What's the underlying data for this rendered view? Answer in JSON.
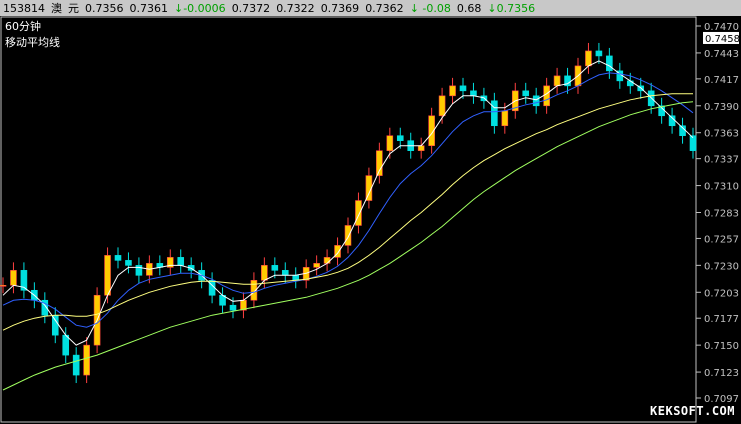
{
  "header": {
    "code": "153814",
    "name1": "澳",
    "name2": "元",
    "open": "0.7356",
    "high": "0.7361",
    "change": "↓-0.0006",
    "v1": "0.7372",
    "v2": "0.7322",
    "v3": "0.7369",
    "v4": "0.7362",
    "change2": "↓ -0.08",
    "v5": "0.68",
    "change3": "↓0.7356"
  },
  "overlay": {
    "period": "60分钟",
    "indicator": "移动平均线"
  },
  "watermark": "KEKSOFT.COM",
  "colors": {
    "up": "#ff4040",
    "down": "#00e0e0",
    "bull_body": "#ffcc00",
    "ma_short": "#ffffff",
    "ma_mid": "#3060ff",
    "ma_long": "#ffff80",
    "ma_longer": "#a0ff60",
    "axis": "#c0c0c0",
    "price_box": "#ffffff"
  },
  "chart_data": {
    "type": "line",
    "ylim": [
      0.7097,
      0.747
    ],
    "yticks": [
      "0.7470",
      "0.7443",
      "0.7417",
      "0.7390",
      "0.7363",
      "0.7337",
      "0.7310",
      "0.7283",
      "0.7257",
      "0.7230",
      "0.7203",
      "0.7177",
      "0.7150",
      "0.7123",
      "0.7097"
    ],
    "current_price": "0.7458",
    "series": [
      {
        "key": "price",
        "values": [
          0.721,
          0.7225,
          0.7205,
          0.7195,
          0.718,
          0.716,
          0.714,
          0.712,
          0.715,
          0.72,
          0.724,
          0.7235,
          0.723,
          0.722,
          0.7232,
          0.7228,
          0.7238,
          0.723,
          0.7225,
          0.7215,
          0.72,
          0.719,
          0.7185,
          0.7195,
          0.7215,
          0.723,
          0.7225,
          0.722,
          0.7215,
          0.7228,
          0.7232,
          0.7238,
          0.725,
          0.727,
          0.7295,
          0.732,
          0.7345,
          0.736,
          0.7355,
          0.7345,
          0.735,
          0.738,
          0.74,
          0.741,
          0.7405,
          0.74,
          0.7395,
          0.737,
          0.7385,
          0.7405,
          0.74,
          0.739,
          0.741,
          0.742,
          0.741,
          0.743,
          0.7445,
          0.744,
          0.7425,
          0.7415,
          0.741,
          0.7405,
          0.739,
          0.738,
          0.737,
          0.736,
          0.7345
        ]
      },
      {
        "key": "ma_short",
        "values": [
          0.72,
          0.721,
          0.7208,
          0.72,
          0.719,
          0.7175,
          0.716,
          0.715,
          0.7155,
          0.7175,
          0.72,
          0.722,
          0.7228,
          0.7228,
          0.7226,
          0.7228,
          0.723,
          0.723,
          0.7227,
          0.722,
          0.721,
          0.72,
          0.7194,
          0.7195,
          0.7203,
          0.7215,
          0.722,
          0.722,
          0.722,
          0.7222,
          0.7226,
          0.7232,
          0.7242,
          0.7258,
          0.728,
          0.7302,
          0.7325,
          0.7342,
          0.735,
          0.735,
          0.735,
          0.7362,
          0.7378,
          0.7392,
          0.74,
          0.74,
          0.7398,
          0.7388,
          0.7388,
          0.7395,
          0.7398,
          0.7396,
          0.7402,
          0.741,
          0.7412,
          0.742,
          0.743,
          0.7435,
          0.743,
          0.7422,
          0.7415,
          0.7408,
          0.7398,
          0.7388,
          0.7378,
          0.7368,
          0.7358
        ]
      },
      {
        "key": "ma_mid",
        "values": [
          0.719,
          0.7195,
          0.7196,
          0.7195,
          0.7192,
          0.7186,
          0.7178,
          0.717,
          0.7168,
          0.7172,
          0.7182,
          0.7195,
          0.7205,
          0.7212,
          0.7216,
          0.7218,
          0.722,
          0.7222,
          0.7222,
          0.722,
          0.7216,
          0.721,
          0.7205,
          0.7202,
          0.7203,
          0.7207,
          0.721,
          0.7212,
          0.7214,
          0.7216,
          0.7219,
          0.7223,
          0.7229,
          0.7238,
          0.725,
          0.7265,
          0.7282,
          0.7298,
          0.7312,
          0.7322,
          0.733,
          0.734,
          0.7352,
          0.7364,
          0.7374,
          0.738,
          0.7384,
          0.7384,
          0.7385,
          0.7388,
          0.7391,
          0.7393,
          0.7396,
          0.7401,
          0.7405,
          0.741,
          0.7416,
          0.7421,
          0.7423,
          0.7422,
          0.742,
          0.7416,
          0.7411,
          0.7405,
          0.7398,
          0.7391,
          0.7383
        ]
      },
      {
        "key": "ma_long",
        "values": [
          0.7165,
          0.717,
          0.7174,
          0.7177,
          0.7179,
          0.718,
          0.718,
          0.7179,
          0.7179,
          0.7181,
          0.7185,
          0.719,
          0.7195,
          0.7199,
          0.7203,
          0.7206,
          0.7209,
          0.7211,
          0.7213,
          0.7214,
          0.7214,
          0.7213,
          0.7212,
          0.7211,
          0.7211,
          0.7212,
          0.7213,
          0.7214,
          0.7215,
          0.7216,
          0.7218,
          0.722,
          0.7223,
          0.7227,
          0.7233,
          0.724,
          0.7248,
          0.7257,
          0.7266,
          0.7275,
          0.7283,
          0.7292,
          0.7301,
          0.7311,
          0.732,
          0.7328,
          0.7335,
          0.7341,
          0.7347,
          0.7352,
          0.7357,
          0.7362,
          0.7366,
          0.7371,
          0.7375,
          0.7379,
          0.7383,
          0.7387,
          0.739,
          0.7393,
          0.7396,
          0.7398,
          0.74,
          0.7401,
          0.7402,
          0.7402,
          0.7402
        ]
      },
      {
        "key": "ma_longer",
        "values": [
          0.7105,
          0.711,
          0.7115,
          0.712,
          0.7124,
          0.7128,
          0.7131,
          0.7134,
          0.7137,
          0.714,
          0.7144,
          0.7148,
          0.7152,
          0.7156,
          0.716,
          0.7164,
          0.7168,
          0.7171,
          0.7174,
          0.7177,
          0.718,
          0.7182,
          0.7184,
          0.7186,
          0.7188,
          0.719,
          0.7192,
          0.7194,
          0.7196,
          0.7198,
          0.7201,
          0.7204,
          0.7207,
          0.7211,
          0.7215,
          0.722,
          0.7226,
          0.7232,
          0.7239,
          0.7246,
          0.7253,
          0.7261,
          0.7269,
          0.7278,
          0.7287,
          0.7296,
          0.7304,
          0.7311,
          0.7318,
          0.7325,
          0.7331,
          0.7337,
          0.7343,
          0.7349,
          0.7354,
          0.7359,
          0.7364,
          0.7369,
          0.7373,
          0.7377,
          0.7381,
          0.7384,
          0.7387,
          0.7389,
          0.7391,
          0.7393,
          0.7394
        ]
      }
    ]
  }
}
